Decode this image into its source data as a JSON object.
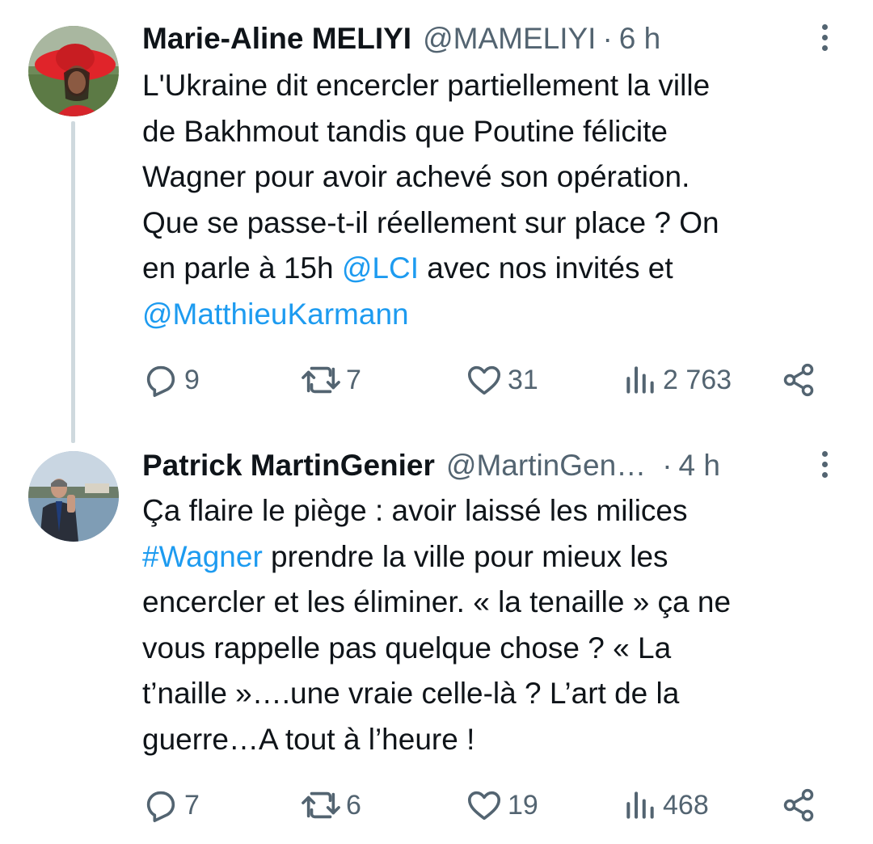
{
  "tweets": [
    {
      "name": "Marie-Aline MELIYI",
      "handle": "@MAMELIYI",
      "time": "6 h",
      "text_lines": [
        [
          {
            "t": "L'Ukraine dit encercler partiellement la ville"
          }
        ],
        [
          {
            "t": "de Bakhmout tandis que Poutine félicite"
          }
        ],
        [
          {
            "t": "Wagner pour avoir achevé son opération."
          }
        ],
        [
          {
            "t": "Que se passe-t-il réellement sur place ? On"
          }
        ],
        [
          {
            "t": "en parle à 15h "
          },
          {
            "t": "@LCI",
            "link": true
          },
          {
            "t": " avec nos invités et"
          }
        ],
        [
          {
            "t": "@MatthieuKarmann",
            "link": true
          }
        ]
      ],
      "replies": "9",
      "retweets": "7",
      "likes": "31",
      "views": "2 763"
    },
    {
      "name": "Patrick MartinGenier",
      "handle": "@MartinGen…",
      "time": "4 h",
      "text_lines": [
        [
          {
            "t": "Ça flaire le piège : avoir laissé les milices"
          }
        ],
        [
          {
            "t": "#Wagner",
            "link": true
          },
          {
            "t": " prendre la ville pour mieux les"
          }
        ],
        [
          {
            "t": "encercler et les éliminer. « la tenaille » ça ne"
          }
        ],
        [
          {
            "t": "vous rappelle pas quelque chose ? « La"
          }
        ],
        [
          {
            "t": "t’naille »….une vraie celle-là ? L’art de la"
          }
        ],
        [
          {
            "t": "guerre…A tout à l’heure !"
          }
        ]
      ],
      "replies": "7",
      "retweets": "6",
      "likes": "19",
      "views": "468"
    }
  ],
  "icons": [
    "reply-icon",
    "retweet-icon",
    "like-icon",
    "views-icon",
    "share-icon",
    "more-icon"
  ],
  "colors": {
    "link": "#1d9bf0",
    "secondary": "#536471",
    "text": "#0f1419",
    "thread": "#cfd9de"
  }
}
